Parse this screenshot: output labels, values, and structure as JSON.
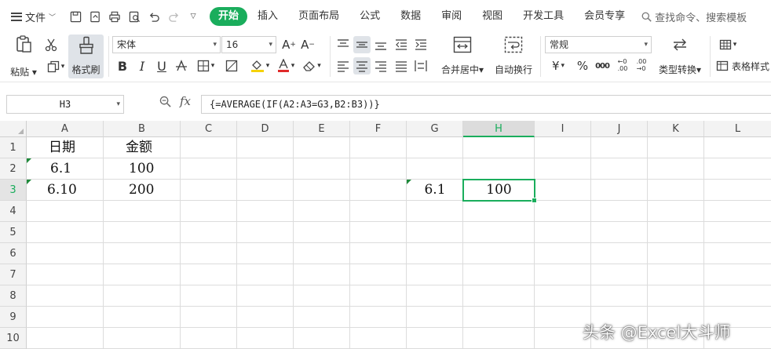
{
  "menubar": {
    "file_label": "文件",
    "tabs": [
      {
        "label": "开始",
        "active": true
      },
      {
        "label": "插入"
      },
      {
        "label": "页面布局"
      },
      {
        "label": "公式"
      },
      {
        "label": "数据"
      },
      {
        "label": "审阅"
      },
      {
        "label": "视图"
      },
      {
        "label": "开发工具"
      },
      {
        "label": "会员专享"
      }
    ],
    "search_placeholder": "查找命令、搜索模板"
  },
  "ribbon": {
    "paste_label": "粘贴",
    "format_painter_label": "格式刷",
    "font_name": "宋体",
    "font_size": "16",
    "bold": "B",
    "italic": "I",
    "underline": "U",
    "merge_center_label": "合并居中",
    "wrap_text_label": "自动换行",
    "number_format": "常规",
    "type_convert_label": "类型转换",
    "table_style_label": "表格样式"
  },
  "formula_bar": {
    "name_box": "H3",
    "fx_label": "fx",
    "formula": "{=AVERAGE(IF(A2:A3=G3,B2:B3))}"
  },
  "sheet": {
    "columns": [
      "A",
      "B",
      "C",
      "D",
      "E",
      "F",
      "G",
      "H",
      "I",
      "J",
      "K",
      "L"
    ],
    "rows": [
      "1",
      "2",
      "3",
      "4",
      "5",
      "6",
      "7",
      "8",
      "9",
      "10"
    ],
    "selected_column": "H",
    "selected_row": "3",
    "cells": {
      "A1": "日期",
      "B1": "金额",
      "A2": "6.1",
      "B2": "100",
      "A3": "6.10",
      "B3": "200",
      "G3": "6.1",
      "H3": "100"
    }
  },
  "watermark": "头条 @Excel大斗师",
  "colors": {
    "accent": "#1aad5c",
    "header_bg": "#f3f3f3",
    "gridline": "#dcdcdc"
  }
}
